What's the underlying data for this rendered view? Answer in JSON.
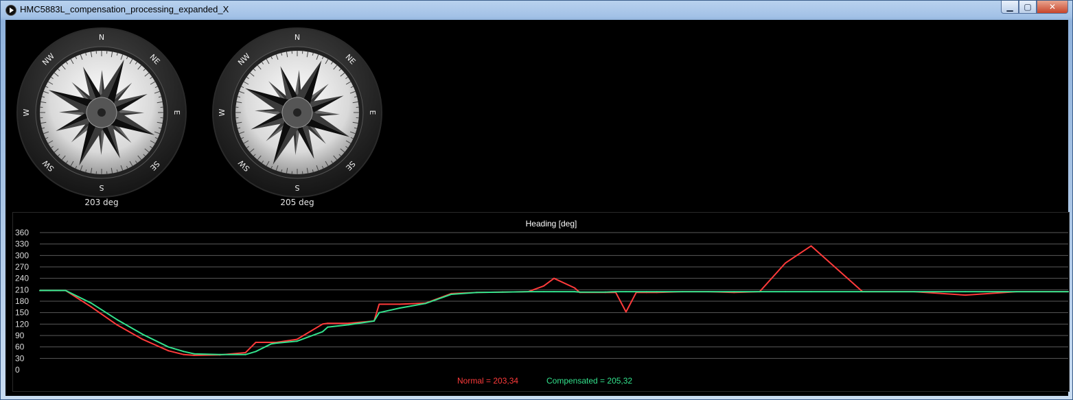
{
  "window": {
    "title": "HMC5883L_compensation_processing_expanded_X",
    "minimize_symbol": "▁",
    "maximize_symbol": "▢",
    "close_symbol": "✕"
  },
  "compasses": [
    {
      "heading_label": "203 deg",
      "heading": 203,
      "dial_labels": {
        "N": "N",
        "NE": "NE",
        "E": "E",
        "SE": "SE",
        "S": "S",
        "SW": "SW",
        "W": "W",
        "NW": "NW"
      }
    },
    {
      "heading_label": "205 deg",
      "heading": 205,
      "dial_labels": {
        "N": "N",
        "NE": "NE",
        "E": "E",
        "SE": "SE",
        "S": "S",
        "SW": "SW",
        "W": "W",
        "NW": "NW"
      }
    }
  ],
  "chart_data": {
    "type": "line",
    "title": "Heading [deg]",
    "ylim": [
      0,
      360
    ],
    "yticks": [
      0,
      30,
      60,
      90,
      120,
      150,
      180,
      210,
      240,
      270,
      300,
      330,
      360
    ],
    "grid": true,
    "x": [
      0,
      2,
      4,
      5,
      10,
      15,
      20,
      25,
      28,
      30,
      35,
      40,
      42,
      45,
      46,
      50,
      55,
      56,
      60,
      65,
      66,
      70,
      75,
      80,
      85,
      90,
      95,
      98,
      100,
      104,
      105,
      110,
      112,
      114,
      116,
      118,
      120,
      125,
      130,
      135,
      140,
      145,
      150,
      160,
      170,
      180,
      190,
      200
    ],
    "series": [
      {
        "name": "Normal",
        "color": "#ff3b3b",
        "values": [
          208,
          208,
          208,
          208,
          165,
          118,
          80,
          50,
          40,
          38,
          39,
          45,
          72,
          72,
          72,
          80,
          120,
          122,
          122,
          128,
          172,
          172,
          175,
          200,
          203,
          204,
          205,
          220,
          240,
          215,
          203,
          203,
          203,
          152,
          203,
          203,
          203,
          205,
          205,
          203,
          205,
          280,
          325,
          205,
          205,
          196,
          205,
          205
        ]
      },
      {
        "name": "Compensated",
        "color": "#33e38d",
        "values": [
          208,
          208,
          208,
          208,
          175,
          132,
          93,
          60,
          48,
          42,
          40,
          40,
          48,
          68,
          70,
          75,
          100,
          112,
          118,
          128,
          150,
          162,
          174,
          198,
          203,
          204,
          205,
          205,
          205,
          205,
          204,
          204,
          205,
          205,
          205,
          205,
          205,
          205,
          205,
          205,
          205,
          205,
          205,
          205,
          205,
          205,
          205,
          205
        ]
      }
    ],
    "legend": [
      {
        "text": "Normal = 203,34",
        "color": "#ff3b3b"
      },
      {
        "text": "Compensated = 205,32",
        "color": "#33e38d"
      }
    ]
  }
}
